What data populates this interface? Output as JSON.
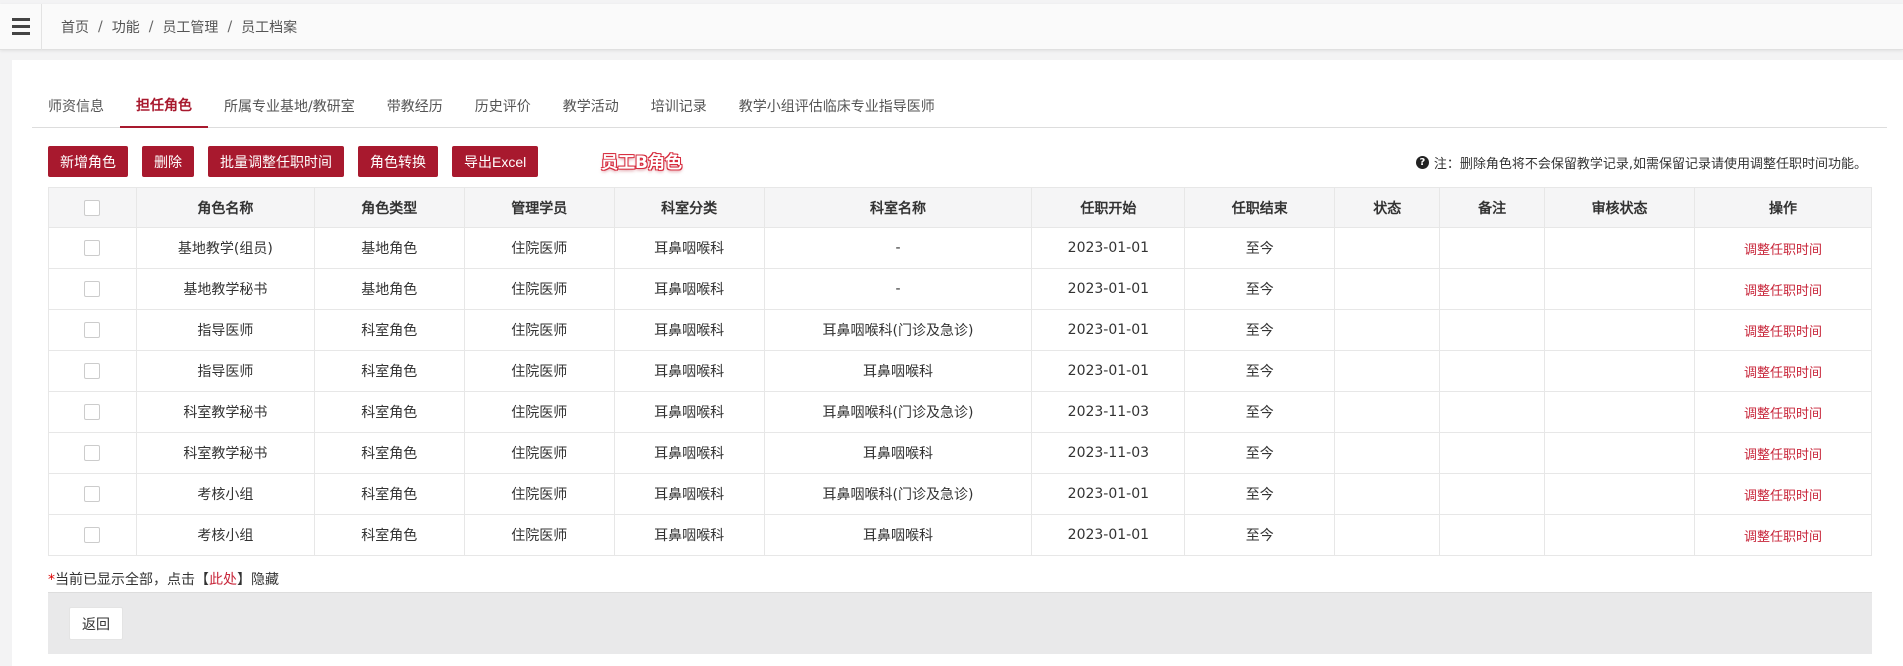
{
  "breadcrumb": [
    "首页",
    "功能",
    "员工管理",
    "员工档案"
  ],
  "tabs": [
    {
      "label": "师资信息",
      "active": false
    },
    {
      "label": "担任角色",
      "active": true
    },
    {
      "label": "所属专业基地/教研室",
      "active": false
    },
    {
      "label": "带教经历",
      "active": false
    },
    {
      "label": "历史评价",
      "active": false
    },
    {
      "label": "教学活动",
      "active": false
    },
    {
      "label": "培训记录",
      "active": false
    },
    {
      "label": "教学小组评估临床专业指导医师",
      "active": false
    }
  ],
  "toolbar": {
    "buttons": [
      "新增角色",
      "删除",
      "批量调整任职时间",
      "角色转换",
      "导出Excel"
    ]
  },
  "watermark": "员工B角色",
  "note": "注：删除角色将不会保留教学记录,如需保留记录请使用调整任职时间功能。",
  "table": {
    "headers": [
      "角色名称",
      "角色类型",
      "管理学员",
      "科室分类",
      "科室名称",
      "任职开始",
      "任职结束",
      "状态",
      "备注",
      "审核状态",
      "操作"
    ],
    "rows": [
      [
        "基地教学(组员)",
        "基地角色",
        "住院医师",
        "耳鼻咽喉科",
        "-",
        "2023-01-01",
        "至今",
        "",
        "",
        "",
        "调整任职时间"
      ],
      [
        "基地教学秘书",
        "基地角色",
        "住院医师",
        "耳鼻咽喉科",
        "-",
        "2023-01-01",
        "至今",
        "",
        "",
        "",
        "调整任职时间"
      ],
      [
        "指导医师",
        "科室角色",
        "住院医师",
        "耳鼻咽喉科",
        "耳鼻咽喉科(门诊及急诊)",
        "2023-01-01",
        "至今",
        "",
        "",
        "",
        "调整任职时间"
      ],
      [
        "指导医师",
        "科室角色",
        "住院医师",
        "耳鼻咽喉科",
        "耳鼻咽喉科",
        "2023-01-01",
        "至今",
        "",
        "",
        "",
        "调整任职时间"
      ],
      [
        "科室教学秘书",
        "科室角色",
        "住院医师",
        "耳鼻咽喉科",
        "耳鼻咽喉科(门诊及急诊)",
        "2023-11-03",
        "至今",
        "",
        "",
        "",
        "调整任职时间"
      ],
      [
        "科室教学秘书",
        "科室角色",
        "住院医师",
        "耳鼻咽喉科",
        "耳鼻咽喉科",
        "2023-11-03",
        "至今",
        "",
        "",
        "",
        "调整任职时间"
      ],
      [
        "考核小组",
        "科室角色",
        "住院医师",
        "耳鼻咽喉科",
        "耳鼻咽喉科(门诊及急诊)",
        "2023-01-01",
        "至今",
        "",
        "",
        "",
        "调整任职时间"
      ],
      [
        "考核小组",
        "科室角色",
        "住院医师",
        "耳鼻咽喉科",
        "耳鼻咽喉科",
        "2023-01-01",
        "至今",
        "",
        "",
        "",
        "调整任职时间"
      ]
    ]
  },
  "footer": {
    "prefix": "当前已显示全部，点击【",
    "link": "此处",
    "suffix": "】隐藏",
    "back_label": "返回"
  },
  "colors": {
    "accent": "#a8192e",
    "link": "#c8263a"
  }
}
